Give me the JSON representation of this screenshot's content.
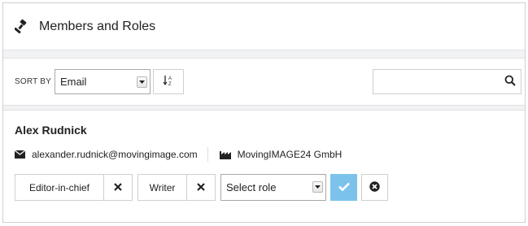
{
  "header": {
    "title": "Members and Roles",
    "icon": "gavel-icon"
  },
  "toolbar": {
    "sort_label": "SORT BY",
    "sort_selected": "Email",
    "sort_order_icon": "sort-alpha-asc-icon",
    "search_value": "",
    "search_icon": "search-icon"
  },
  "member": {
    "name": "Alex Rudnick",
    "email": "alexander.rudnick@movingimage.com",
    "company": "MovingIMAGE24 GmbH",
    "roles": [
      {
        "label": "Editor-in-chief"
      },
      {
        "label": "Writer"
      }
    ],
    "role_select": "Select role"
  },
  "colors": {
    "accent": "#7cc3ec",
    "border": "#cfcfcf",
    "band": "#f1f2f4"
  }
}
